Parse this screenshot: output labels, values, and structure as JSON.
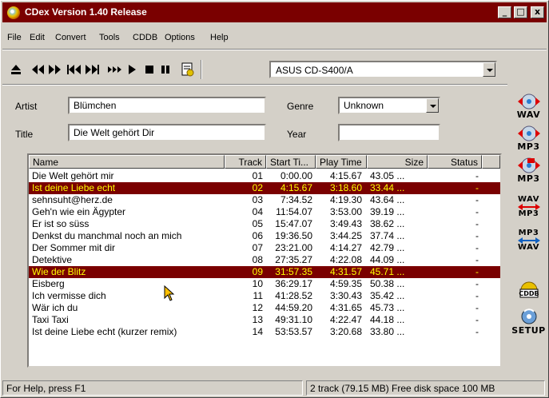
{
  "window": {
    "title": "CDex Version 1.40 Release",
    "controls": {
      "minimize": "_",
      "maximize": "□",
      "close": "x"
    }
  },
  "menu": [
    "File",
    "Edit",
    "Convert",
    "Tools",
    "CDDB",
    "Options",
    "Help"
  ],
  "toolbar": {
    "drive": "ASUS   CD-S400/A",
    "icons": [
      "eject-icon",
      "rewind-icon",
      "fast-forward-icon",
      "previous-track-icon",
      "next-track-icon",
      "skip-icon",
      "play-icon",
      "stop-icon",
      "pause-icon",
      "cd-info-icon"
    ]
  },
  "form": {
    "artist_label": "Artist",
    "artist_value": "Blümchen",
    "title_label": "Title",
    "title_value": "Die Welt gehört Dir",
    "genre_label": "Genre",
    "genre_value": "Unknown",
    "year_label": "Year",
    "year_value": ""
  },
  "table": {
    "columns": [
      "Name",
      "Track",
      "Start Ti...",
      "Play Time",
      "Size",
      "Status"
    ],
    "rows": [
      {
        "name": "Die Welt gehört mir",
        "track": "01",
        "start": "0:00.00",
        "play": "4:15.67",
        "size": "43.05 ...",
        "status": "-",
        "selected": false
      },
      {
        "name": "Ist deine Liebe echt",
        "track": "02",
        "start": "4:15.67",
        "play": "3:18.60",
        "size": "33.44 ...",
        "status": "-",
        "selected": true
      },
      {
        "name": "sehnsuht@herz.de",
        "track": "03",
        "start": "7:34.52",
        "play": "4:19.30",
        "size": "43.64 ...",
        "status": "-",
        "selected": false
      },
      {
        "name": "Geh'n wie ein Ägypter",
        "track": "04",
        "start": "11:54.07",
        "play": "3:53.00",
        "size": "39.19 ...",
        "status": "-",
        "selected": false
      },
      {
        "name": "Er ist so süss",
        "track": "05",
        "start": "15:47.07",
        "play": "3:49.43",
        "size": "38.62 ...",
        "status": "-",
        "selected": false
      },
      {
        "name": "Denkst du manchmal noch an mich",
        "track": "06",
        "start": "19:36.50",
        "play": "3:44.25",
        "size": "37.74 ...",
        "status": "-",
        "selected": false
      },
      {
        "name": "Der Sommer mit dir",
        "track": "07",
        "start": "23:21.00",
        "play": "4:14.27",
        "size": "42.79 ...",
        "status": "-",
        "selected": false
      },
      {
        "name": "Detektive",
        "track": "08",
        "start": "27:35.27",
        "play": "4:22.08",
        "size": "44.09 ...",
        "status": "-",
        "selected": false
      },
      {
        "name": "Wie der Blitz",
        "track": "09",
        "start": "31:57.35",
        "play": "4:31.57",
        "size": "45.71 ...",
        "status": "-",
        "selected": true
      },
      {
        "name": "Eisberg",
        "track": "10",
        "start": "36:29.17",
        "play": "4:59.35",
        "size": "50.38 ...",
        "status": "-",
        "selected": false
      },
      {
        "name": "Ich vermisse dich",
        "track": "11",
        "start": "41:28.52",
        "play": "3:30.43",
        "size": "35.42 ...",
        "status": "-",
        "selected": false
      },
      {
        "name": "Wär ich du",
        "track": "12",
        "start": "44:59.20",
        "play": "4:31.65",
        "size": "45.73 ...",
        "status": "-",
        "selected": false
      },
      {
        "name": "Taxi Taxi",
        "track": "13",
        "start": "49:31.10",
        "play": "4:22.47",
        "size": "44.18 ...",
        "status": "-",
        "selected": false
      },
      {
        "name": "Ist deine Liebe echt (kurzer remix)",
        "track": "14",
        "start": "53:53.57",
        "play": "3:20.68",
        "size": "33.80 ...",
        "status": "-",
        "selected": false
      }
    ]
  },
  "side_buttons": [
    {
      "label": "WAV",
      "icon": "cd-to-wav-icon"
    },
    {
      "label": "MP3",
      "icon": "cd-to-mp3-icon"
    },
    {
      "label": "MP3",
      "icon": "cd-to-mp3-alt-icon"
    },
    {
      "label_top": "WAV",
      "label_bottom": "MP3",
      "icon": "wav-to-mp3-icon"
    },
    {
      "label_top": "MP3",
      "label_bottom": "WAV",
      "icon": "mp3-to-wav-icon"
    },
    {
      "label": "CDDB",
      "icon": "cddb-icon"
    },
    {
      "label": "SETUP",
      "icon": "setup-icon"
    }
  ],
  "status": {
    "help": "For Help, press F1",
    "info": "2 track (79.15 MB) Free disk space  100 MB"
  },
  "colors": {
    "titlebar": "#7a0000",
    "selection_bg": "#7a0000",
    "selection_fg": "#ffff00",
    "face": "#d4d0c8"
  }
}
